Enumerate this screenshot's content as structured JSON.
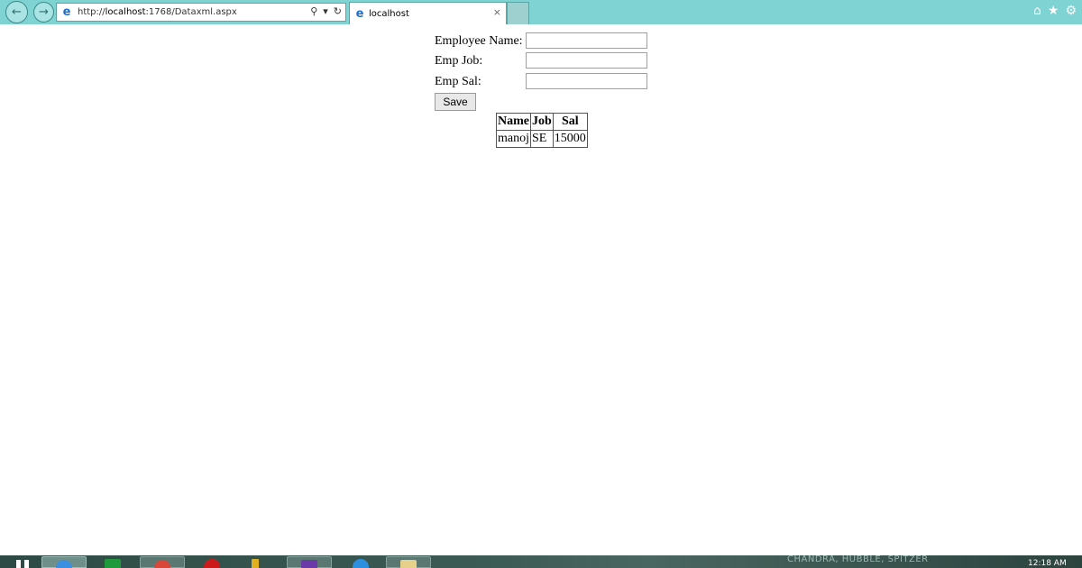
{
  "browser": {
    "url_prefix": "http://",
    "url_host": "localhost",
    "url_rest": ":1768/Dataxml.aspx",
    "tab_title": "localhost",
    "tab_close": "×",
    "icons": [
      "back-arrow-icon",
      "forward-arrow-icon",
      "ie-icon",
      "search-icon",
      "refresh-icon",
      "home-icon",
      "star-icon",
      "gear-icon"
    ]
  },
  "form": {
    "name_label": "Employee Name:",
    "job_label": "Emp Job:",
    "sal_label": "Emp Sal:",
    "name_value": "",
    "job_value": "",
    "sal_value": "",
    "save_label": "Save"
  },
  "table": {
    "headers": [
      "Name",
      "Job",
      "Sal"
    ],
    "rows": [
      [
        "manoj",
        "SE",
        "15000"
      ]
    ]
  },
  "taskbar": {
    "wallpaper_text": "CHANDRA, HUBBLE, SPITZER",
    "clock": "12:18 AM"
  },
  "colors": {
    "chrome_bg": "#7fd3d3",
    "taskbar_bg": "#3c5b54"
  }
}
